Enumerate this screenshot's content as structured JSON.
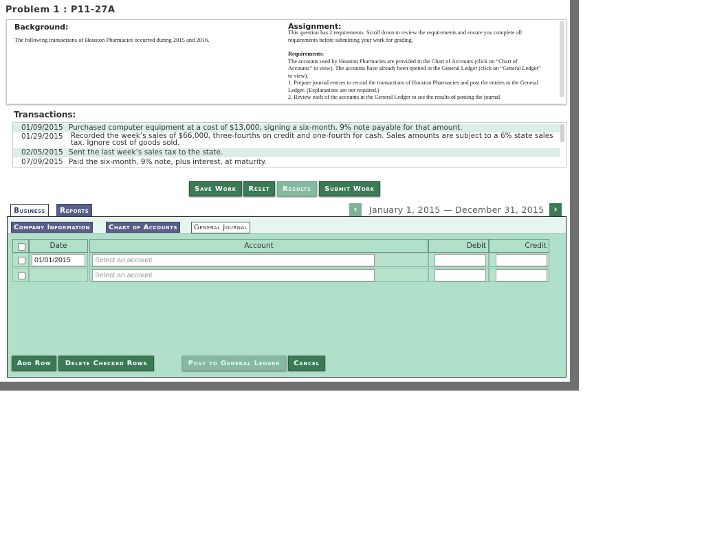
{
  "problem_title": "Problem 1 : P11-27A",
  "background": {
    "heading": "Background:",
    "text": "The following transactions of Houston Pharmacies occurred during 2015 and 2016."
  },
  "assignment": {
    "heading": "Assignment:",
    "intro": "This question has 2 requirements. Scroll down to review the requirements and ensure you complete all requirements before submitting your work for grading.",
    "requirements_heading": "Requirements:",
    "requirements_text": "The accounts used by Houston Pharmacies are provided in the Chart of Accounts (click on “Chart of Accounts” to view). The accounts have already been opened in the General Ledger (click on “General Ledger” to view).",
    "req1": "1. Prepare journal entries to record the transactions of Houston Pharmacies and post the entries to the General Ledger. (Explanations are not required.)",
    "req2": "2. Review each of the accounts in the General Ledger to see the results of posting the journal"
  },
  "transactions": {
    "heading": "Transactions:",
    "rows": [
      {
        "date": "01/09/2015",
        "desc": "Purchased computer equipment at a cost of $13,000, signing a six-month, 9% note payable for that amount."
      },
      {
        "date": "01/29/2015",
        "desc": "Recorded the week’s sales of $66,000, three-fourths on credit and one-fourth for cash. Sales amounts are subject to a 6% state sales tax. Ignore cost of goods sold."
      },
      {
        "date": "02/05/2015",
        "desc": "Sent the last week’s sales tax to the state."
      },
      {
        "date": "07/09/2015",
        "desc": "Paid the six-month, 9% note, plus interest, at maturity."
      }
    ]
  },
  "actions": {
    "save": "Save Work",
    "reset": "Reset",
    "results": "Results",
    "submit": "Submit Work"
  },
  "main_tabs": {
    "business": "Business",
    "reports": "Reports"
  },
  "date_range": "January 1, 2015 — December 31, 2015",
  "sub_tabs": {
    "company": "Company Information",
    "chart": "Chart of Accounts",
    "journal": "General Journal"
  },
  "journal": {
    "headers": {
      "date": "Date",
      "account": "Account",
      "debit": "Debit",
      "credit": "Credit"
    },
    "rows": [
      {
        "date": "01/01/2015",
        "account_placeholder": "Select an account",
        "debit": "",
        "credit": ""
      },
      {
        "date": "",
        "account_placeholder": "Select an account",
        "debit": "",
        "credit": ""
      }
    ]
  },
  "journal_actions": {
    "add_row": "Add Row",
    "delete_rows": "Delete Checked Rows",
    "post": "Post to General Ledger",
    "cancel": "Cancel"
  },
  "icons": {
    "prev": "chevron-left-icon",
    "next": "chevron-right-icon"
  },
  "colors": {
    "button_green": "#3b7a55",
    "panel_green": "#b0e0c9",
    "tab_purple": "#5a5e8a"
  }
}
